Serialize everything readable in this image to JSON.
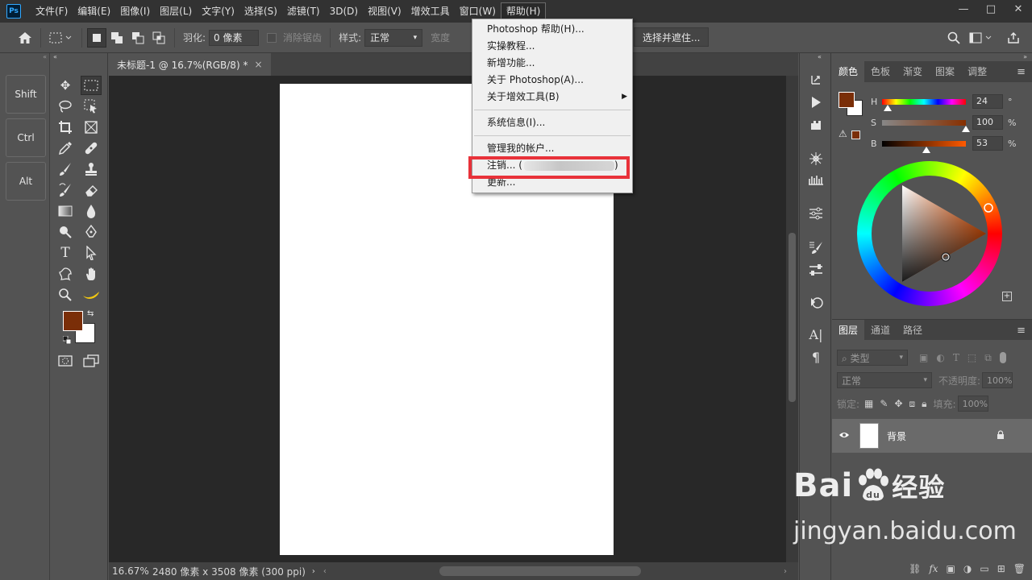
{
  "menubar": {
    "logo": "Ps",
    "items": [
      "文件(F)",
      "编辑(E)",
      "图像(I)",
      "图层(L)",
      "文字(Y)",
      "选择(S)",
      "滤镜(T)",
      "3D(D)",
      "视图(V)",
      "增效工具",
      "窗口(W)",
      "帮助(H)"
    ],
    "window_controls": {
      "minimize": "—",
      "maximize": "□",
      "close": "✕"
    }
  },
  "options": {
    "feather_label": "羽化:",
    "feather_value": "0 像素",
    "antialias_label": "消除锯齿",
    "style_label": "样式:",
    "style_value": "正常",
    "width_label": "宽度",
    "select_mask_button": "选择并遮住..."
  },
  "modifier_keys": [
    "Shift",
    "Ctrl",
    "Alt"
  ],
  "document": {
    "tab_title": "未标题-1 @ 16.7%(RGB/8) *",
    "tab_close": "×",
    "zoom": "16.67%",
    "doc_info": "2480 像素 x 3508 像素 (300 ppi)"
  },
  "help_menu": {
    "items": [
      {
        "label": "Photoshop 帮助(H)...",
        "submenu": false
      },
      {
        "label": "实操教程...",
        "submenu": false
      },
      {
        "label": "新增功能...",
        "submenu": false
      },
      {
        "label": "关于 Photoshop(A)...",
        "submenu": false
      },
      {
        "label": "关于增效工具(B)",
        "submenu": true
      },
      {
        "label": "系统信息(I)...",
        "submenu": false
      },
      {
        "label": "管理我的帐户...",
        "submenu": false
      },
      {
        "label": "注销... (",
        "submenu": false,
        "suffix": ")"
      },
      {
        "label": "更新...",
        "submenu": false
      }
    ]
  },
  "color_panel": {
    "tabs": [
      "颜色",
      "色板",
      "渐变",
      "图案",
      "调整"
    ],
    "active_tab": "颜色",
    "foreground_color": "#7a2e08",
    "background_color": "#ffffff",
    "sliders": [
      {
        "label": "H",
        "value": "24",
        "unit": "°",
        "position": 0.07
      },
      {
        "label": "S",
        "value": "100",
        "unit": "%",
        "position": 1.0
      },
      {
        "label": "B",
        "value": "53",
        "unit": "%",
        "position": 0.53
      }
    ]
  },
  "layers_panel": {
    "tabs": [
      "图层",
      "通道",
      "路径"
    ],
    "active_tab": "图层",
    "filter_label": "类型",
    "blend_mode": "正常",
    "opacity_label": "不透明度:",
    "opacity_value": "100%",
    "lock_label": "锁定:",
    "fill_label": "填充:",
    "fill_value": "100%",
    "layers": [
      {
        "name": "背景",
        "visible": true,
        "locked": true
      }
    ]
  },
  "watermark": {
    "logo_text": "Bai",
    "logo_suffix": "经验",
    "url": "jingyan.baidu.com"
  },
  "accent_colors": {
    "highlight": "#e8323a",
    "ps_blue": "#31a8ff"
  }
}
